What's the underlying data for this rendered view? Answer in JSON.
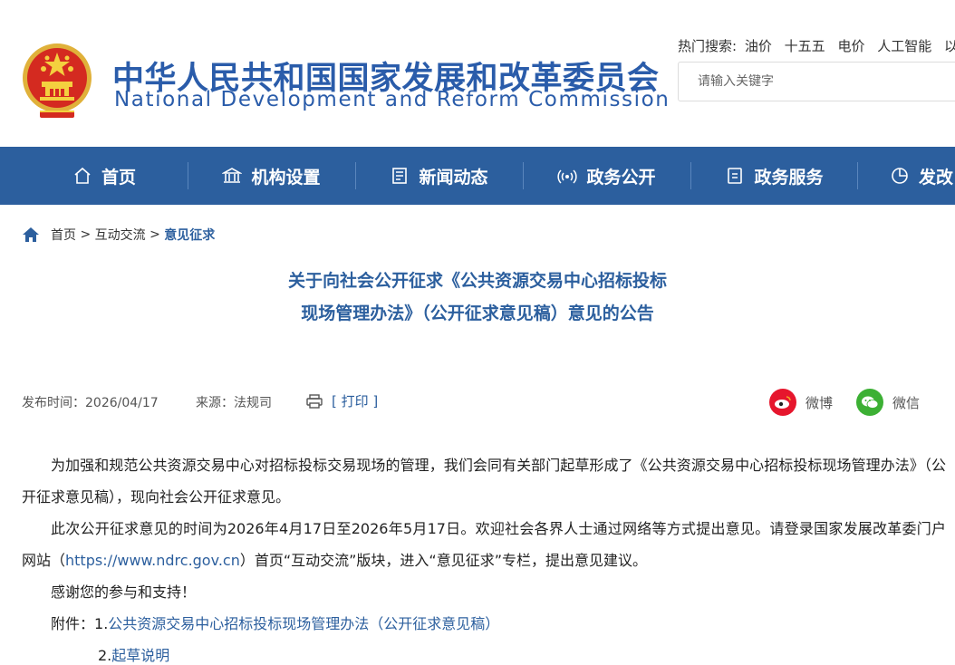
{
  "header": {
    "title_cn": "中华人民共和国国家发展和改革委员会",
    "title_en": "National Development and Reform Commission",
    "hot_search_label": "热门搜索:",
    "hot_keywords": [
      "油价",
      "十五五",
      "电价",
      "人工智能",
      "以旧"
    ],
    "search_placeholder": "请输入关键字"
  },
  "nav": {
    "items": [
      {
        "label": "首页",
        "icon": "home-icon"
      },
      {
        "label": "机构设置",
        "icon": "institution-icon"
      },
      {
        "label": "新闻动态",
        "icon": "news-icon"
      },
      {
        "label": "政务公开",
        "icon": "broadcast-icon"
      },
      {
        "label": "政务服务",
        "icon": "service-icon"
      },
      {
        "label": "发改",
        "icon": "pie-chart-icon"
      }
    ]
  },
  "breadcrumb": {
    "home": "首页",
    "sep1": " > ",
    "section": "互动交流",
    "sep2": " > ",
    "current": "意见征求"
  },
  "article": {
    "title_line1": "关于向社会公开征求《公共资源交易中心招标投标",
    "title_line2": "现场管理办法》（公开征求意见稿）意见的公告",
    "publish_time": "发布时间：2026/04/17",
    "source": "来源：法规司",
    "print_label": "[ 打印 ]",
    "share_weibo": "微博",
    "share_wechat": "微信",
    "paragraph1": "为加强和规范公共资源交易中心对招标投标交易现场的管理，我们会同有关部门起草形成了《公共资源交易中心招标投标现场管理办法》（公开征求意见稿），现向社会公开征求意见。",
    "paragraph2_a": "此次公开征求意见的时间为2026年4月17日至2026年5月17日。欢迎社会各界人士通过网络等方式提出意见。请登录国家发展改革委门户网站（",
    "paragraph2_link": "https://www.ndrc.gov.cn",
    "paragraph2_b": "）首页“互动交流”版块，进入“意见征求”专栏，提出意见建议。",
    "paragraph3": "感谢您的参与和支持！",
    "attachment_label": "附件：",
    "attachment1_num": "1.",
    "attachment1": "公共资源交易中心招标投标现场管理办法（公开征求意见稿）",
    "attachment2_num": "2.",
    "attachment2": "起草说明"
  },
  "colors": {
    "brand_blue": "#2c5f9e",
    "emblem_red": "#d42a20",
    "emblem_gold": "#f4c430"
  }
}
